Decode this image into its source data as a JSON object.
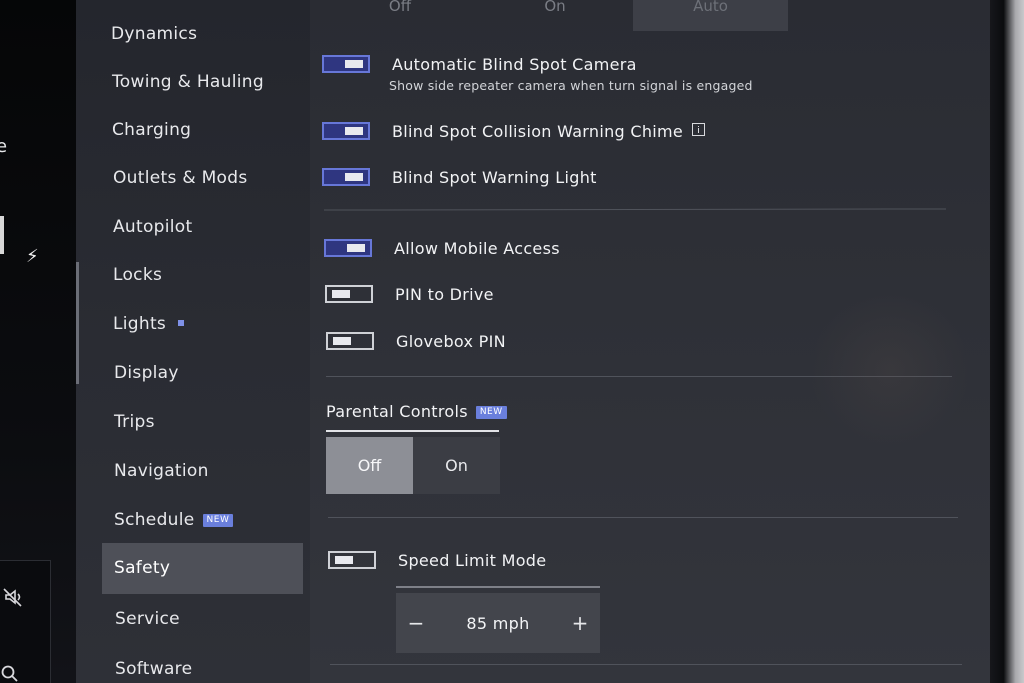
{
  "top_segment": {
    "options": [
      "Off",
      "On",
      "Auto"
    ]
  },
  "sidebar": {
    "items": [
      {
        "label": "Dynamics"
      },
      {
        "label": "Towing & Hauling"
      },
      {
        "label": "Charging"
      },
      {
        "label": "Outlets & Mods"
      },
      {
        "label": "Autopilot"
      },
      {
        "label": "Locks"
      },
      {
        "label": "Lights"
      },
      {
        "label": "Display"
      },
      {
        "label": "Trips"
      },
      {
        "label": "Navigation"
      },
      {
        "label": "Schedule",
        "badge": "NEW"
      },
      {
        "label": "Safety"
      },
      {
        "label": "Service"
      },
      {
        "label": "Software"
      }
    ],
    "active": "Safety"
  },
  "left_strip": {
    "edge_char": "e"
  },
  "settings": {
    "blind_spot_camera": {
      "label": "Automatic Blind Spot Camera",
      "sub": "Show side repeater camera when turn signal is engaged",
      "on": true
    },
    "blind_spot_chime": {
      "label": "Blind Spot Collision Warning Chime",
      "on": true
    },
    "blind_spot_light": {
      "label": "Blind Spot Warning Light",
      "on": true
    },
    "mobile_access": {
      "label": "Allow Mobile Access",
      "on": true
    },
    "pin_to_drive": {
      "label": "PIN to Drive",
      "on": false
    },
    "glovebox_pin": {
      "label": "Glovebox PIN",
      "on": false
    },
    "speed_limit_mode": {
      "label": "Speed Limit Mode",
      "on": false
    }
  },
  "parental_controls": {
    "title": "Parental Controls",
    "badge": "NEW",
    "options": [
      "Off",
      "On"
    ],
    "selected": "Off"
  },
  "speed_limit": {
    "minus": "−",
    "value": "85 mph",
    "plus": "+"
  },
  "colors": {
    "accent_toggle": "#6777d8",
    "badge": "#6a7fdc",
    "active_nav": "#4e5058"
  },
  "icons": {
    "bolt": "bolt-icon",
    "mute": "mute-icon",
    "search": "search-icon",
    "info": "info-icon"
  }
}
